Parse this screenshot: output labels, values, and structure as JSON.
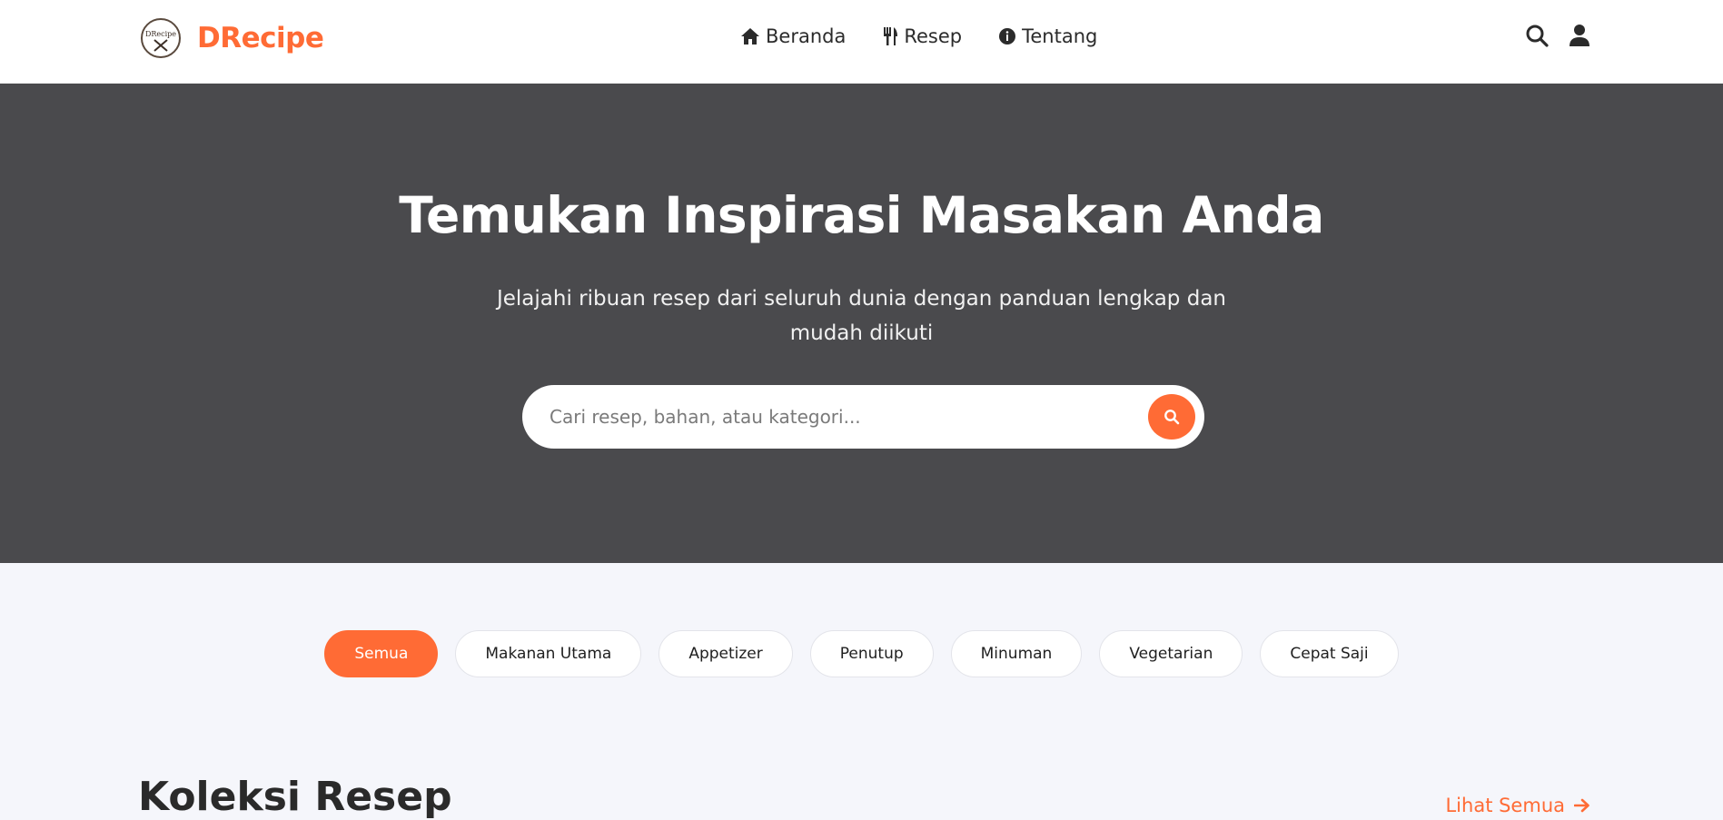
{
  "header": {
    "brand": "DRecipe",
    "logo_text": "DRecipe",
    "nav": [
      {
        "label": "Beranda",
        "icon": "home-icon"
      },
      {
        "label": "Resep",
        "icon": "utensils-icon"
      },
      {
        "label": "Tentang",
        "icon": "info-icon"
      }
    ],
    "actions": [
      "search-icon",
      "user-icon"
    ]
  },
  "hero": {
    "title": "Temukan Inspirasi Masakan Anda",
    "subtitle": "Jelajahi ribuan resep dari seluruh dunia dengan panduan lengkap dan mudah diikuti",
    "search": {
      "placeholder": "Cari resep, bahan, atau kategori...",
      "value": ""
    }
  },
  "categories": [
    {
      "label": "Semua",
      "active": true
    },
    {
      "label": "Makanan Utama",
      "active": false
    },
    {
      "label": "Appetizer",
      "active": false
    },
    {
      "label": "Penutup",
      "active": false
    },
    {
      "label": "Minuman",
      "active": false
    },
    {
      "label": "Vegetarian",
      "active": false
    },
    {
      "label": "Cepat Saji",
      "active": false
    }
  ],
  "section": {
    "title": "Koleksi Resep",
    "see_all": "Lihat Semua"
  },
  "colors": {
    "accent": "#ff6b35",
    "hero_bg": "#4a4a4d",
    "page_bg": "#f5f6fb"
  }
}
